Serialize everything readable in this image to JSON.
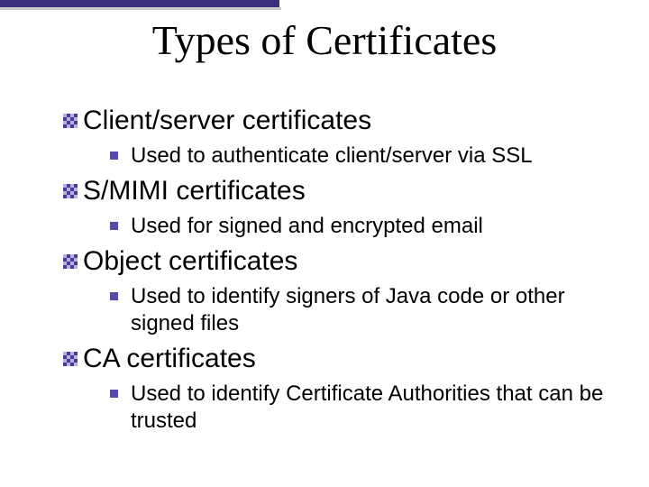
{
  "title": "Types of Certificates",
  "items": [
    {
      "label": "Client/server certificates",
      "sub": "Used to authenticate client/server via SSL"
    },
    {
      "label": "S/MIMI certificates",
      "sub": "Used for signed and encrypted email"
    },
    {
      "label": "Object certificates",
      "sub": "Used to identify signers of Java code or other signed files"
    },
    {
      "label": "CA certificates",
      "sub": "Used to identify Certificate Authorities that can be trusted"
    }
  ]
}
